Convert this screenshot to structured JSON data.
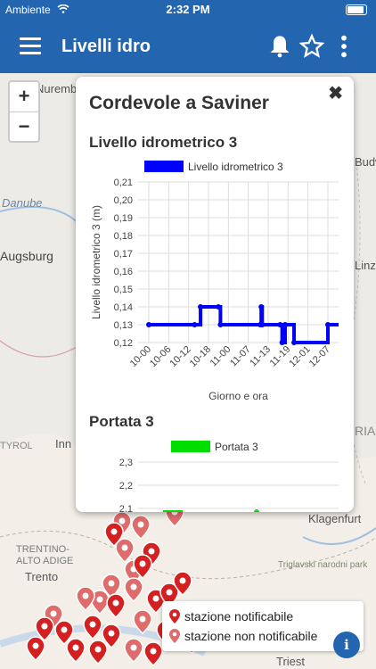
{
  "status": {
    "carrier": "Ambiente",
    "time": "2:32 PM"
  },
  "appbar": {
    "title": "Livelli idro"
  },
  "map": {
    "labels": [
      "Nuremb",
      "Danube",
      "Augsburg",
      "Inn",
      "TYROL",
      "TRENTINO-ALTO ADIGE",
      "Trento",
      "Linz",
      "Budw",
      "Klagenfurt",
      "Triglavski narodni park",
      "RIA",
      "Triest"
    ],
    "zoom_in": "+",
    "zoom_out": "−"
  },
  "popup": {
    "title": "Cordevole a Saviner",
    "close": "✖",
    "section1": "Livello idrometrico 3",
    "section2": "Portata 3"
  },
  "chart_data": [
    {
      "type": "line",
      "title": "Livello idrometrico 3",
      "legend": "Livello idrometrico 3",
      "xlabel": "Giorno e ora",
      "ylabel": "Livello idrometrico 3 (m)",
      "ylim": [
        0.12,
        0.21
      ],
      "yticks": [
        "0,21",
        "0,20",
        "0,19",
        "0,18",
        "0,17",
        "0,16",
        "0,15",
        "0,14",
        "0,13",
        "0,12"
      ],
      "xticks": [
        "10-00",
        "10-06",
        "10-12",
        "10-18",
        "11-00",
        "11-07",
        "11-13",
        "11-19",
        "12-01",
        "12-07"
      ],
      "series": [
        {
          "name": "Livello idrometrico 3",
          "color": "#0000ff",
          "x": [
            0,
            2.3,
            2.6,
            3.5,
            3.6,
            5.6,
            5.65,
            5.7,
            6.6,
            6.7,
            6.85,
            7.3,
            9.0
          ],
          "y": [
            0.13,
            0.13,
            0.14,
            0.14,
            0.13,
            0.13,
            0.14,
            0.13,
            0.13,
            0.12,
            0.13,
            0.12,
            0.13
          ]
        }
      ]
    },
    {
      "type": "line",
      "title": "Portata 3",
      "legend": "Portata 3",
      "yticks": [
        "2,3",
        "2,2",
        "2,1"
      ],
      "series": [
        {
          "name": "Portata 3",
          "color": "#00dd00"
        }
      ]
    }
  ],
  "legend": {
    "notifiable": "stazione notificabile",
    "not_notifiable": "stazione non notificabile",
    "notifiable_color": "#d42020",
    "not_notifiable_color": "#e06b6b"
  },
  "info_label": "i"
}
